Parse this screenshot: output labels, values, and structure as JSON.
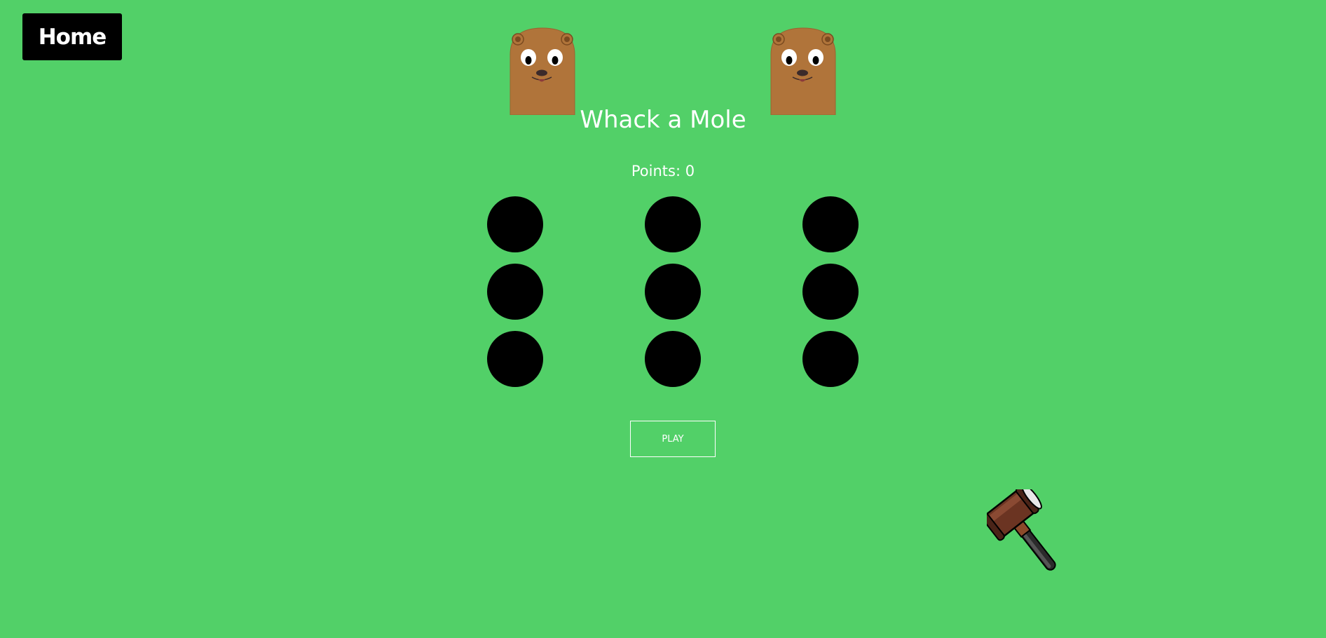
{
  "nav": {
    "home_label": "Home"
  },
  "game": {
    "title": "Whack a Mole",
    "points_label": "Points: 0",
    "play_label": "PLAY",
    "holes": [
      1,
      2,
      3,
      4,
      5,
      6,
      7,
      8,
      9
    ]
  },
  "icons": {
    "mole": "mole-icon",
    "hammer": "hammer-cursor-icon"
  },
  "colors": {
    "background": "#52d068",
    "hole": "#000000",
    "mole_fur": "#b0743a",
    "text": "#ffffff"
  }
}
